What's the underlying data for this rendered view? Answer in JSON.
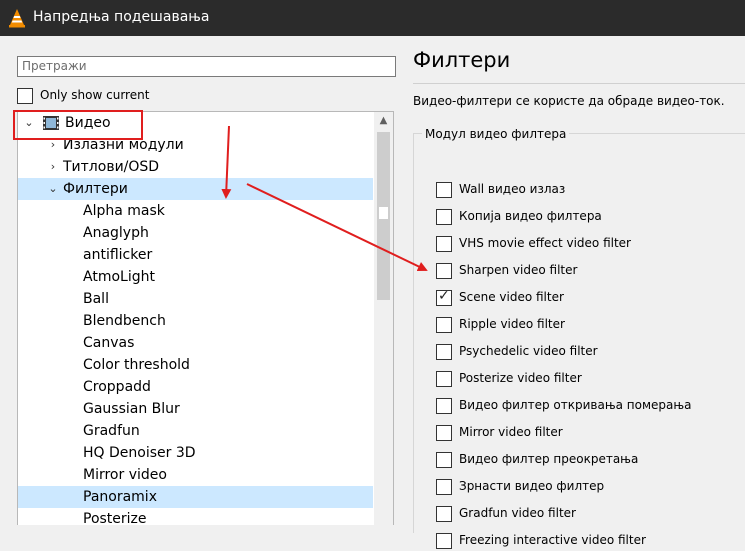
{
  "window": {
    "title": "Напредња подешавања",
    "icon": "vlc-cone-icon"
  },
  "search": {
    "placeholder": "Претражи",
    "value": ""
  },
  "only_show_current": {
    "label": "Only show current",
    "checked": false
  },
  "tree": {
    "items": [
      {
        "label": "Видео",
        "arrow": "⌄",
        "icon": "film-icon",
        "selected": false
      },
      {
        "label": "Излазни модули",
        "arrow": "›",
        "selected": false
      },
      {
        "label": "Титлови/OSD",
        "arrow": "›",
        "selected": false
      },
      {
        "label": "Филтери",
        "arrow": "⌄",
        "selected": true
      },
      {
        "label": "Alpha mask"
      },
      {
        "label": "Anaglyph"
      },
      {
        "label": "antiflicker"
      },
      {
        "label": "AtmoLight"
      },
      {
        "label": "Ball"
      },
      {
        "label": "Blendbench"
      },
      {
        "label": "Canvas"
      },
      {
        "label": "Color threshold"
      },
      {
        "label": "Croppadd"
      },
      {
        "label": "Gaussian Blur"
      },
      {
        "label": "Gradfun"
      },
      {
        "label": "HQ Denoiser 3D"
      },
      {
        "label": "Mirror video"
      },
      {
        "label": "Panoramix",
        "selected": true
      },
      {
        "label": "Posterize"
      }
    ]
  },
  "panel": {
    "title": "Филтери",
    "description": "Видео-филтери се користе да обраде видео-ток.",
    "group_label": "Модул видео филтера",
    "filters": [
      {
        "label": "Wall видео излаз",
        "checked": false
      },
      {
        "label": "Копија видео филтера",
        "checked": false
      },
      {
        "label": "VHS movie effect video filter",
        "checked": false
      },
      {
        "label": "Sharpen video filter",
        "checked": false
      },
      {
        "label": "Scene video filter",
        "checked": true
      },
      {
        "label": "Ripple video filter",
        "checked": false
      },
      {
        "label": "Psychedelic video filter",
        "checked": false
      },
      {
        "label": "Posterize video filter",
        "checked": false
      },
      {
        "label": "Видео филтер откривања померања",
        "checked": false
      },
      {
        "label": "Mirror video filter",
        "checked": false
      },
      {
        "label": "Видео филтер преокретања",
        "checked": false
      },
      {
        "label": "Зрнасти видео филтер",
        "checked": false
      },
      {
        "label": "Gradfun video filter",
        "checked": false
      },
      {
        "label": "Freezing interactive video filter",
        "checked": false
      }
    ]
  },
  "colors": {
    "annotation_red": "#e01e1e",
    "selection_blue": "#cce8ff",
    "titlebar": "#2b2b2b"
  }
}
